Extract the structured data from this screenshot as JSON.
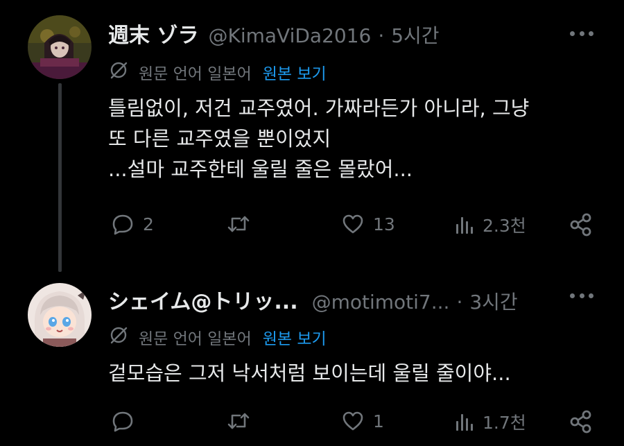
{
  "tweets": [
    {
      "name": "週末 ゾラ",
      "handle": "@KimaViDa2016",
      "separator": "·",
      "time": "5시간",
      "translate_label": "원문 언어 일본어",
      "translate_link": "원본 보기",
      "text": "틀림없이, 저건 교주였어. 가짜라든가 아니라, 그냥\n또 다른 교주였을 뿐이었지\n...설마 교주한테 울릴 줄은 몰랐어...",
      "replies": "2",
      "retweets": "",
      "likes": "13",
      "views": "2.3천"
    },
    {
      "name": "シェイム@トリッ...",
      "handle": "@motimoti7...",
      "separator": "·",
      "time": "3시간",
      "translate_label": "원문 언어 일본어",
      "translate_link": "원본 보기",
      "text": "겉모습은 그저 낙서처럼 보이는데 울릴 줄이야...",
      "replies": "",
      "retweets": "",
      "likes": "1",
      "views": "1.7천"
    }
  ],
  "colors": {
    "background": "#000000",
    "text": "#e7e9ea",
    "secondary": "#71767b",
    "link": "#1d9bf0",
    "thread_line": "#333639"
  },
  "icons": [
    "more-icon",
    "translate-icon",
    "reply-icon",
    "retweet-icon",
    "like-icon",
    "views-icon",
    "share-icon"
  ]
}
